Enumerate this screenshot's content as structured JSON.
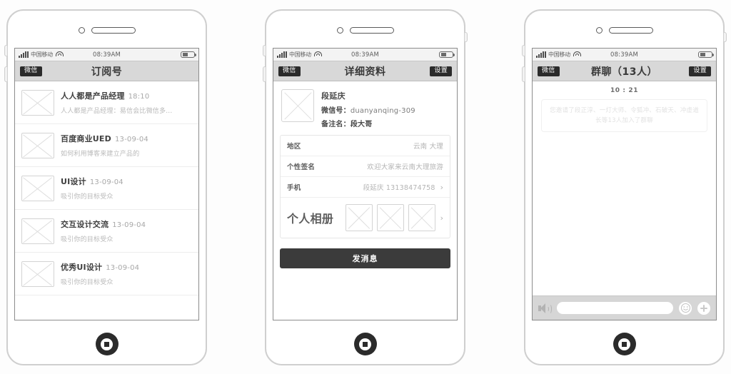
{
  "status_bar": {
    "carrier": "中国移动",
    "time": "08:39AM",
    "signal_icon": "signal-bars-icon",
    "wifi_icon": "wifi-icon",
    "battery_icon": "battery-icon"
  },
  "phone1": {
    "nav": {
      "back_label": "微信",
      "title": "订阅号"
    },
    "list": [
      {
        "name": "人人都是产品经理",
        "date": "18:10",
        "desc": "人人都是产品经理：易信会比微信多..."
      },
      {
        "name": "百度商业UED",
        "date": "13-09-04",
        "desc": "如何利用博客来建立产品的"
      },
      {
        "name": "UI设计",
        "date": "13-09-04",
        "desc": "吸引你的目标受众"
      },
      {
        "name": "交互设计交流",
        "date": "13-09-04",
        "desc": "吸引你的目标受众"
      },
      {
        "name": "优秀UI设计",
        "date": "13-09-04",
        "desc": "吸引你的目标受众"
      }
    ]
  },
  "phone2": {
    "nav": {
      "back_label": "微信",
      "title": "详细资料",
      "settings_label": "设置"
    },
    "profile": {
      "name": "段延庆",
      "wechat_id_label": "微信号：",
      "wechat_id": "duanyanqing-309",
      "remark_label": "备注名：",
      "remark": "段大哥"
    },
    "info_rows": [
      {
        "label": "地区",
        "value": "云南 大理",
        "chevron": false
      },
      {
        "label": "个性签名",
        "value": "欢迎大家来云南大理旅游",
        "chevron": false
      },
      {
        "label": "手机",
        "value": "段延庆 13138474758",
        "chevron": true
      }
    ],
    "album": {
      "label": "个人相册",
      "thumb_count": 3,
      "chevron": "›"
    },
    "send_button": "发消息"
  },
  "phone3": {
    "nav": {
      "back_label": "微信",
      "title": "群聊（13人）",
      "settings_label": "设置"
    },
    "chat": {
      "timestamp": "10 : 21",
      "system_message": "您邀请了段正淳、一灯大师、令狐冲、石破天、冲虚道长等13人加入了群聊"
    },
    "input_bar": {
      "voice_icon": "voice-speaker-icon",
      "input_placeholder": "",
      "emoji_icon": "smiley-icon",
      "plus_icon": "plus-icon"
    }
  },
  "colors": {
    "frame": "#cfcfcf",
    "navbar": "#d8d8d8",
    "dark_button": "#2b2b2b",
    "send_button": "#3b3b3b",
    "input_bar": "#d6d6d6"
  }
}
